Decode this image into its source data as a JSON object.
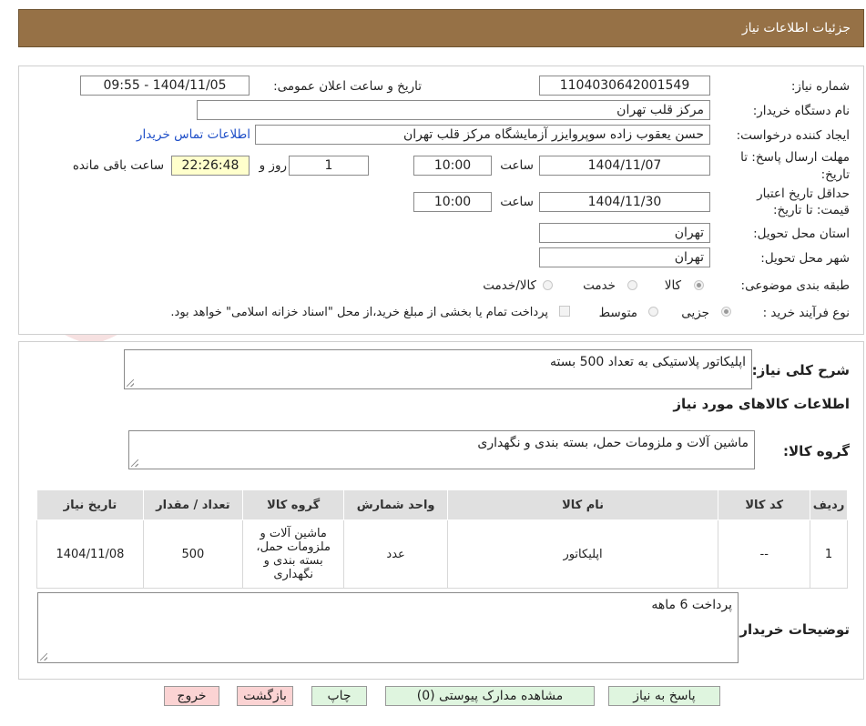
{
  "header": {
    "title": "جزئیات اطلاعات نیاز"
  },
  "form": {
    "need_number_label": "شماره نیاز:",
    "need_number": "1104030642001549",
    "announce_label": "تاریخ و ساعت اعلان عمومی:",
    "announce_value": "1404/11/05 - 09:55",
    "buyer_org_label": "نام دستگاه خریدار:",
    "buyer_org": "مرکز قلب تهران",
    "requester_label": "ایجاد کننده درخواست:",
    "requester": "حسن یعقوب زاده سوپروایزر آزمایشگاه مرکز قلب تهران",
    "contact_link": "اطلاعات تماس خریدار",
    "deadline_label_1": "مهلت ارسال پاسخ: تا",
    "deadline_label_2": "تاریخ:",
    "deadline_date": "1404/11/07",
    "time_label": "ساعت",
    "deadline_time": "10:00",
    "days_value": "1",
    "days_label": "روز و",
    "remaining_time": "22:26:48",
    "remaining_label": "ساعت باقی مانده",
    "validity_label_1": "حداقل تاریخ اعتبار",
    "validity_label_2": "قیمت: تا تاریخ:",
    "validity_date": "1404/11/30",
    "validity_time_label": "ساعت",
    "validity_time": "10:00",
    "province_label": "استان محل تحویل:",
    "province": "تهران",
    "city_label": "شهر محل تحویل:",
    "city": "تهران",
    "category_label": "طبقه بندی موضوعی:",
    "category_options": [
      "کالا",
      "خدمت",
      "کالا/خدمت"
    ],
    "process_label": "نوع فرآیند خرید :",
    "process_options": [
      "جزیی",
      "متوسط"
    ],
    "treasury_note": "پرداخت تمام یا بخشی از مبلغ خرید،از محل \"اسناد خزانه اسلامی\" خواهد بود."
  },
  "need": {
    "summary_label": "شرح کلی نیاز:",
    "summary": "اپلیکاتور پلاستیکی به تعداد 500 بسته",
    "goods_info_heading": "اطلاعات کالاهای مورد نیاز",
    "goods_group_label": "گروه کالا:",
    "goods_group": "ماشین آلات و ملزومات حمل، بسته بندی و نگهداری"
  },
  "table": {
    "headers": [
      "ردیف",
      "کد کالا",
      "نام کالا",
      "واحد شمارش",
      "گروه کالا",
      "تعداد / مقدار",
      "تاریخ نیاز"
    ],
    "rows": [
      [
        "1",
        "--",
        "اپلیکاتور",
        "عدد",
        "ماشین آلات و ملزومات حمل، بسته بندی و نگهداری",
        "500",
        "1404/11/08"
      ]
    ]
  },
  "buyer_notes": {
    "label": "توضیحات خریدار:",
    "text": "پرداخت 6 ماهه"
  },
  "buttons": {
    "reply": "پاسخ به نیاز",
    "attachments": "مشاهده مدارک پیوستی (0)",
    "print": "چاپ",
    "back": "بازگشت",
    "exit": "خروج"
  },
  "watermark": {
    "text": "AriaTender.neT"
  },
  "colors": {
    "header_bg": "#967146",
    "link": "#1f4fc8",
    "highlight": "#ffffcc",
    "green_button": "#dff5df",
    "red_button": "#fbd3d3"
  }
}
